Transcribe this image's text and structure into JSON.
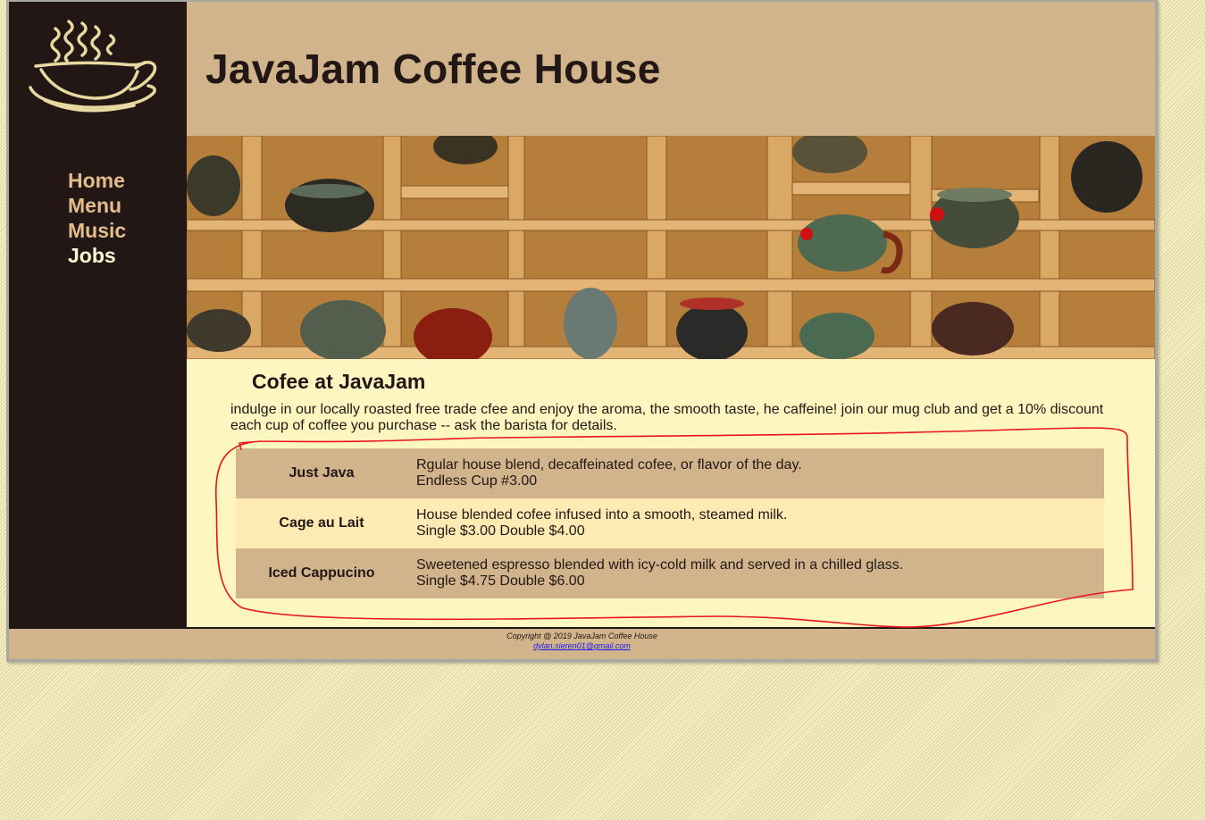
{
  "site": {
    "title": "JavaJam Coffee House"
  },
  "nav": {
    "items": [
      {
        "label": "Home"
      },
      {
        "label": "Menu"
      },
      {
        "label": "Music"
      },
      {
        "label": "Jobs"
      }
    ]
  },
  "main": {
    "heading": "Cofee at JavaJam",
    "intro": "indulge in our locally roasted free trade cfee and enjoy the aroma, the smooth taste, he caffeine! join our mug club and get a 10% discount each cup of coffee you purchase -- ask the barista for details.",
    "menu": [
      {
        "name": "Just Java",
        "desc": "Rgular house blend, decaffeinated cofee, or flavor of the day.",
        "price": "Endless Cup #3.00"
      },
      {
        "name": "Cage au Lait",
        "desc": "House blended cofee infused into a smooth, steamed milk.",
        "price": "Single $3.00 Double $4.00"
      },
      {
        "name": "Iced Cappucino",
        "desc": "Sweetened espresso blended with icy-cold milk and served in a chilled glass.",
        "price": "Single $4.75 Double $6.00"
      }
    ]
  },
  "footer": {
    "copyright": "Copyright @ 2019 JavaJam Coffee House",
    "email": "dylan.sieren01@gmail.com"
  },
  "colors": {
    "accent": "#d1b48c",
    "dark": "#221714",
    "content_bg": "#fef6c1",
    "annotation": "#e8141a"
  }
}
